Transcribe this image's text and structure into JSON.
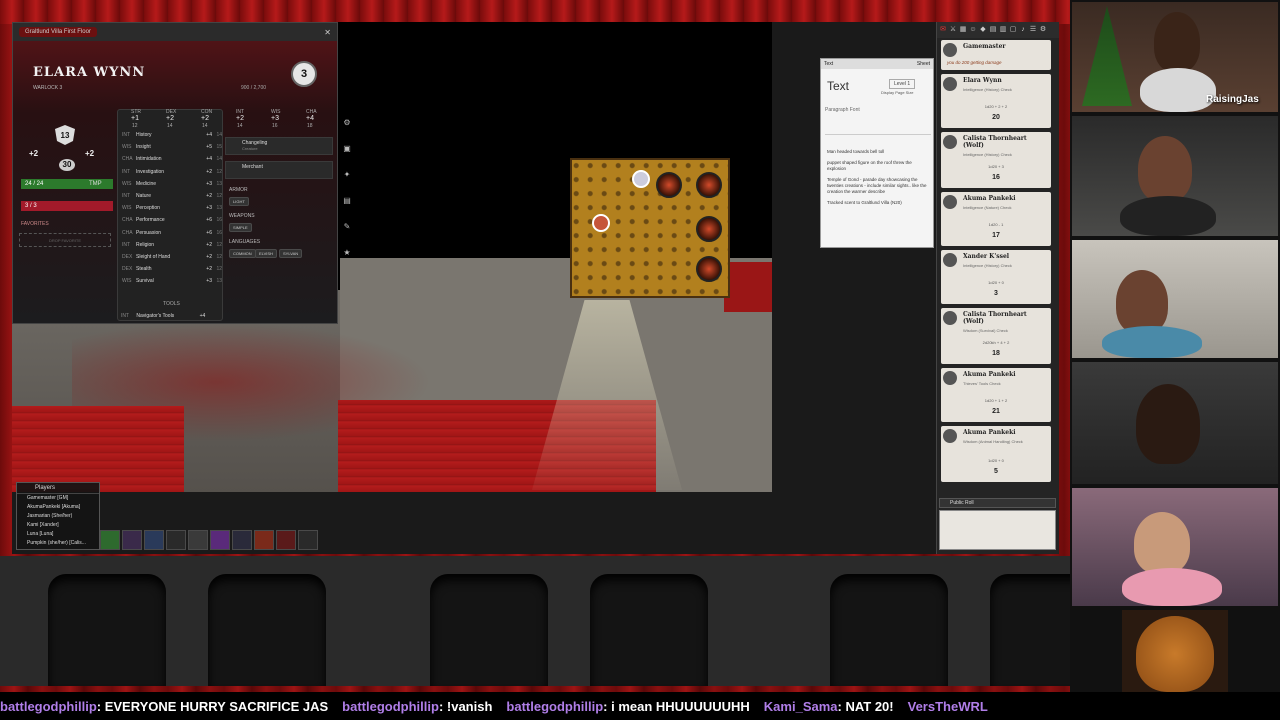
{
  "sheet": {
    "tab_label": "Graltlund Villa First Floor",
    "name": "ELARA WYNN",
    "class_line": "WARLOCK 3",
    "level": "3",
    "xp": "900 / 2,700",
    "ac": "13",
    "initiative": "+2",
    "proficiency": "+2",
    "speed": "30",
    "hp": "24 / 24",
    "tmp_label": "TMP",
    "hit_dice": "3 / 3",
    "favorites_label": "FAVORITES",
    "drop_favorites": "DROP FAVORITE",
    "abilities": [
      {
        "abbr": "STR",
        "mod": "+1",
        "score": "12"
      },
      {
        "abbr": "DEX",
        "mod": "+2",
        "score": "14"
      },
      {
        "abbr": "CON",
        "mod": "+2",
        "score": "14"
      },
      {
        "abbr": "INT",
        "mod": "+2",
        "score": "14"
      },
      {
        "abbr": "WIS",
        "mod": "+3",
        "score": "16"
      },
      {
        "abbr": "CHA",
        "mod": "+4",
        "score": "18"
      }
    ],
    "skills": [
      {
        "ab": "INT",
        "name": "History",
        "bonus": "+4",
        "pass": "14"
      },
      {
        "ab": "WIS",
        "name": "Insight",
        "bonus": "+5",
        "pass": "15"
      },
      {
        "ab": "CHA",
        "name": "Intimidation",
        "bonus": "+4",
        "pass": "14"
      },
      {
        "ab": "INT",
        "name": "Investigation",
        "bonus": "+2",
        "pass": "12"
      },
      {
        "ab": "WIS",
        "name": "Medicine",
        "bonus": "+3",
        "pass": "13"
      },
      {
        "ab": "INT",
        "name": "Nature",
        "bonus": "+2",
        "pass": "12"
      },
      {
        "ab": "WIS",
        "name": "Perception",
        "bonus": "+3",
        "pass": "13"
      },
      {
        "ab": "CHA",
        "name": "Performance",
        "bonus": "+6",
        "pass": "16"
      },
      {
        "ab": "CHA",
        "name": "Persuasion",
        "bonus": "+6",
        "pass": "16"
      },
      {
        "ab": "INT",
        "name": "Religion",
        "bonus": "+2",
        "pass": "12"
      },
      {
        "ab": "DEX",
        "name": "Sleight of Hand",
        "bonus": "+2",
        "pass": "12"
      },
      {
        "ab": "DEX",
        "name": "Stealth",
        "bonus": "+2",
        "pass": "12"
      },
      {
        "ab": "WIS",
        "name": "Survival",
        "bonus": "+3",
        "pass": "13"
      }
    ],
    "tools_label": "TOOLS",
    "tool": {
      "ab": "INT",
      "name": "Navigator's Tools",
      "bonus": "+4"
    },
    "features": [
      {
        "name": "Changeling",
        "sub": "Creature"
      },
      {
        "name": "Merchant",
        "sub": ""
      }
    ],
    "armor_label": "ARMOR",
    "armor_items": [
      "LIGHT"
    ],
    "weapons_label": "WEAPONS",
    "weapon_items": [
      "SIMPLE"
    ],
    "languages_label": "LANGUAGES",
    "languages": [
      "COMMON",
      "ELVISH",
      "SYLVAN"
    ]
  },
  "editor": {
    "header": "Text",
    "sheet_label": "Sheet",
    "title": "Text",
    "level": "Level 1",
    "page_size": "Display Page Size",
    "toolbar": "Paragraph  Font",
    "body": [
      "Man headed towards bell toll",
      "puppet shaped figure on the roof threw the explosion",
      "Temple of Gond - parade day showcasing the twenties creations - include similar sights.. like the creation the warmer describe",
      "Tracked scent to Graltlund Villa (N20)"
    ]
  },
  "chat": {
    "messages": [
      {
        "who": "Gamemaster",
        "sub": "",
        "flavor": "you do 200 getting damage",
        "roll": "",
        "total": ""
      },
      {
        "who": "Elara Wynn",
        "sub": "Intelligence (History) Check",
        "flavor": "",
        "roll": "1d20 + 2 + 2",
        "total": "20"
      },
      {
        "who": "Calista Thornheart (Wolf)",
        "sub": "Intelligence (History) Check",
        "flavor": "",
        "roll": "1d20 + 3",
        "total": "16"
      },
      {
        "who": "Akuma Pankeki",
        "sub": "Intelligence (Nature) Check",
        "flavor": "",
        "roll": "1d20 - 1",
        "total": "17"
      },
      {
        "who": "Xander K'ssel",
        "sub": "Intelligence (History) Check",
        "flavor": "",
        "roll": "1d20 + 0",
        "total": "3"
      },
      {
        "who": "Calista Thornheart (Wolf)",
        "sub": "Wisdom (Survival) Check",
        "flavor": "",
        "roll": "2d20kh + 4 + 2",
        "total": "18"
      },
      {
        "who": "Akuma Pankeki",
        "sub": "Thieves' Tools Check",
        "flavor": "",
        "roll": "1d20 + 1 + 2",
        "total": "21"
      },
      {
        "who": "Akuma Pankeki",
        "sub": "Wisdom (Animal Handling) Check",
        "flavor": "",
        "roll": "1d20 + 0",
        "total": "5"
      }
    ],
    "roll_mode": "Public Roll"
  },
  "players": {
    "title": "Players",
    "list": [
      "Gamemaster [GM]",
      "AkumaPankeki [Akuma]",
      "Jasmarian (She/her)",
      "Kami [Xander]",
      "Luna [Luna]",
      "Pumpkin (she/her) [Calis..."
    ]
  },
  "stream": {
    "handle": "RaisingJas",
    "chat": [
      {
        "user": "battlegodphillip",
        "text": ": EVERYONE HURRY SACRIFICE JAS"
      },
      {
        "user": "battlegodphillip",
        "text": ": !vanish"
      },
      {
        "user": "battlegodphillip",
        "text": ": i mean HHUUUUUUHH"
      },
      {
        "user": "Kami_Sama",
        "text": ": NAT 20!"
      },
      {
        "user": "VersTheWRL",
        "text": ""
      }
    ]
  }
}
